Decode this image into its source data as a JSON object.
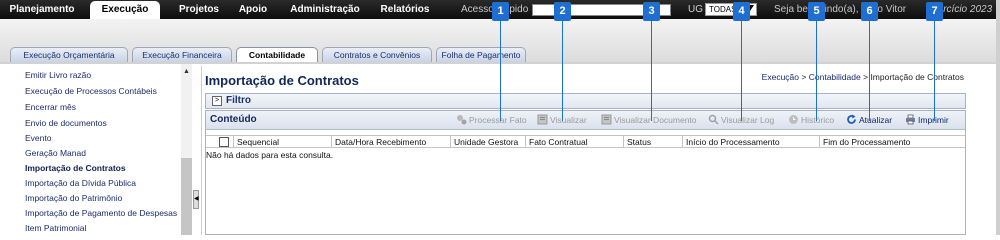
{
  "top_menu": {
    "items": [
      "Planejamento",
      "Execução",
      "Projetos",
      "Apoio",
      "Administração",
      "Relatórios"
    ],
    "active_label": "Execução",
    "quick_access_label": "Acesso Rápido",
    "quick_access_value": "",
    "ug_label": "UG",
    "ug_value": "TODAS",
    "welcome_text": "Seja bem-vindo(a), Joao Vitor",
    "exercise_text": "Exercício 2023"
  },
  "sub_tabs": {
    "items": [
      "Execução Orçamentária",
      "Execução Financeira",
      "Contabilidade",
      "Contratos e Convênios",
      "Folha de Pagamento"
    ],
    "active_label": "Contabilidade"
  },
  "sidebar": {
    "items": [
      "Emitir Livro razão",
      "Execução de Processos Contábeis",
      "Encerrar mês",
      "Envio de documentos",
      "Evento",
      "Geração Manad",
      "Importação de Contratos",
      "Importação da Dívida Pública",
      "Importação do Patrimônio",
      "Importação de Pagamento de Despesas",
      "Item Patrimonial"
    ],
    "active_item": "Importação de Contratos"
  },
  "page": {
    "title": "Importação de Contratos",
    "breadcrumb": {
      "part1": "Execução",
      "sep1": ">",
      "part2": "Contabilidade",
      "sep2": ">",
      "part3": "Importação de Contratos"
    },
    "filter_label": "Filtro",
    "filter_toggle": ">",
    "content_label": "Conteúdo"
  },
  "toolbar": {
    "processar_fato": "Processar Fato",
    "visualizar": "Visualizar",
    "visualizar_documento": "Visualizar Documento",
    "visualizar_log": "Visualizar Log",
    "historico": "Histórico",
    "atualizar": "Atualizar",
    "imprimir": "Imprimir"
  },
  "table": {
    "columns": [
      "Sequencial",
      "Data/Hora Recebimento",
      "Unidade Gestora",
      "Fato Contratual",
      "Status",
      "Início do Processamento",
      "Fim do Processamento"
    ],
    "empty_message": "Não há dados para esta consulta."
  },
  "badges": [
    "1",
    "2",
    "3",
    "4",
    "5",
    "6",
    "7"
  ],
  "colors": {
    "badge": "#1f6fd2",
    "top_bar": "#111111",
    "link": "#1b2c6d"
  }
}
